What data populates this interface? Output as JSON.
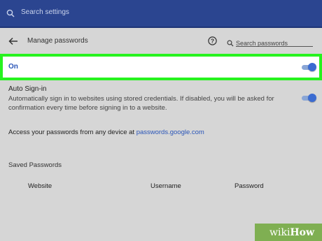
{
  "search_bar": {
    "placeholder": "Search settings",
    "icon": "search-icon"
  },
  "header": {
    "back_icon": "back-arrow-icon",
    "title": "Manage passwords",
    "help_icon": "help-circle-icon",
    "password_search_placeholder": "Search passwords"
  },
  "offer_to_save": {
    "label": "On",
    "enabled": true,
    "highlight_color": "#27f31f"
  },
  "auto_signin": {
    "title": "Auto Sign-in",
    "description": "Automatically sign in to websites using stored credentials. If disabled, you will be asked for confirmation every time before signing in to a website.",
    "enabled": true
  },
  "access": {
    "text": "Access your passwords from any device at ",
    "link": "passwords.google.com"
  },
  "saved_passwords": {
    "title": "Saved Passwords",
    "columns": [
      "Website",
      "Username",
      "Password"
    ]
  },
  "watermark": {
    "prefix": "wiki",
    "suffix": "How"
  },
  "colors": {
    "top_bar": "#2b4590",
    "accent": "#3b6bd1",
    "link": "#2a55b8",
    "background": "#d6d6d6"
  }
}
